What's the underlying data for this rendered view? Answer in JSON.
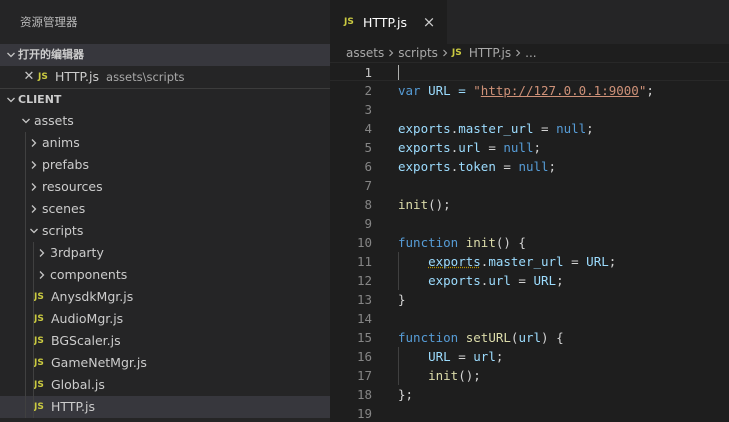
{
  "sidebar": {
    "title": "资源管理器",
    "open_editors": {
      "header": "打开的编辑器",
      "items": [
        {
          "name": "HTTP.js",
          "badge": "JS",
          "path": "assets\\scripts"
        }
      ]
    },
    "workspace": {
      "header": "CLIENT",
      "tree": [
        {
          "label": "assets",
          "kind": "folder",
          "expanded": true,
          "depth": 1
        },
        {
          "label": "anims",
          "kind": "folder",
          "expanded": false,
          "depth": 2
        },
        {
          "label": "prefabs",
          "kind": "folder",
          "expanded": false,
          "depth": 2
        },
        {
          "label": "resources",
          "kind": "folder",
          "expanded": false,
          "depth": 2
        },
        {
          "label": "scenes",
          "kind": "folder",
          "expanded": false,
          "depth": 2
        },
        {
          "label": "scripts",
          "kind": "folder",
          "expanded": true,
          "depth": 2
        },
        {
          "label": "3rdparty",
          "kind": "folder",
          "expanded": false,
          "depth": 3
        },
        {
          "label": "components",
          "kind": "folder",
          "expanded": false,
          "depth": 3
        },
        {
          "label": "AnysdkMgr.js",
          "kind": "file",
          "badge": "JS",
          "depth": 3
        },
        {
          "label": "AudioMgr.js",
          "kind": "file",
          "badge": "JS",
          "depth": 3
        },
        {
          "label": "BGScaler.js",
          "kind": "file",
          "badge": "JS",
          "depth": 3
        },
        {
          "label": "GameNetMgr.js",
          "kind": "file",
          "badge": "JS",
          "depth": 3
        },
        {
          "label": "Global.js",
          "kind": "file",
          "badge": "JS",
          "depth": 3
        },
        {
          "label": "HTTP.js",
          "kind": "file",
          "badge": "JS",
          "depth": 3,
          "selected": true
        }
      ]
    }
  },
  "editor": {
    "tab": {
      "label": "HTTP.js",
      "badge": "JS",
      "close": "×"
    },
    "breadcrumb": {
      "parts": [
        "assets",
        "scripts"
      ],
      "file": "HTTP.js",
      "badge": "JS",
      "trail": "..."
    },
    "active_line": 1,
    "lines": [
      {
        "n": "1",
        "tokens": []
      },
      {
        "n": "2",
        "tokens": [
          {
            "t": "var",
            "c": "kw"
          },
          {
            "t": " URL = ",
            "c": "var"
          },
          {
            "t": "\"",
            "c": "str"
          },
          {
            "t": "http://127.0.0.1:9000",
            "c": "str url"
          },
          {
            "t": "\"",
            "c": "str"
          },
          {
            "t": ";",
            "c": ""
          }
        ]
      },
      {
        "n": "3",
        "tokens": []
      },
      {
        "n": "4",
        "tokens": [
          {
            "t": "exports",
            "c": "var"
          },
          {
            "t": ".",
            "c": ""
          },
          {
            "t": "master_url",
            "c": "var"
          },
          {
            "t": " = ",
            "c": ""
          },
          {
            "t": "null",
            "c": "kw"
          },
          {
            "t": ";",
            "c": ""
          }
        ]
      },
      {
        "n": "5",
        "tokens": [
          {
            "t": "exports",
            "c": "var"
          },
          {
            "t": ".",
            "c": ""
          },
          {
            "t": "url",
            "c": "var"
          },
          {
            "t": " = ",
            "c": ""
          },
          {
            "t": "null",
            "c": "kw"
          },
          {
            "t": ";",
            "c": ""
          }
        ]
      },
      {
        "n": "6",
        "tokens": [
          {
            "t": "exports",
            "c": "var"
          },
          {
            "t": ".",
            "c": ""
          },
          {
            "t": "token",
            "c": "var"
          },
          {
            "t": " = ",
            "c": ""
          },
          {
            "t": "null",
            "c": "kw"
          },
          {
            "t": ";",
            "c": ""
          }
        ]
      },
      {
        "n": "7",
        "tokens": []
      },
      {
        "n": "8",
        "tokens": [
          {
            "t": "init",
            "c": "fn"
          },
          {
            "t": "();",
            "c": ""
          }
        ]
      },
      {
        "n": "9",
        "tokens": []
      },
      {
        "n": "10",
        "tokens": [
          {
            "t": "function",
            "c": "kw"
          },
          {
            "t": " ",
            "c": ""
          },
          {
            "t": "init",
            "c": "fn"
          },
          {
            "t": "() {",
            "c": ""
          }
        ]
      },
      {
        "n": "11",
        "tokens": [
          {
            "t": "    ",
            "c": ""
          },
          {
            "t": "exports",
            "c": "var squig"
          },
          {
            "t": ".",
            "c": ""
          },
          {
            "t": "master_url",
            "c": "var"
          },
          {
            "t": " = ",
            "c": ""
          },
          {
            "t": "URL",
            "c": "var"
          },
          {
            "t": ";",
            "c": ""
          }
        ]
      },
      {
        "n": "12",
        "tokens": [
          {
            "t": "    ",
            "c": ""
          },
          {
            "t": "exports",
            "c": "var"
          },
          {
            "t": ".",
            "c": ""
          },
          {
            "t": "url",
            "c": "var"
          },
          {
            "t": " = ",
            "c": ""
          },
          {
            "t": "URL",
            "c": "var"
          },
          {
            "t": ";",
            "c": ""
          }
        ]
      },
      {
        "n": "13",
        "tokens": [
          {
            "t": "}",
            "c": ""
          }
        ]
      },
      {
        "n": "14",
        "tokens": []
      },
      {
        "n": "15",
        "tokens": [
          {
            "t": "function",
            "c": "kw"
          },
          {
            "t": " ",
            "c": ""
          },
          {
            "t": "setURL",
            "c": "fn"
          },
          {
            "t": "(",
            "c": ""
          },
          {
            "t": "url",
            "c": "var"
          },
          {
            "t": ") {",
            "c": ""
          }
        ]
      },
      {
        "n": "16",
        "tokens": [
          {
            "t": "    ",
            "c": ""
          },
          {
            "t": "URL",
            "c": "var"
          },
          {
            "t": " = ",
            "c": ""
          },
          {
            "t": "url",
            "c": "var"
          },
          {
            "t": ";",
            "c": ""
          }
        ]
      },
      {
        "n": "17",
        "tokens": [
          {
            "t": "    ",
            "c": ""
          },
          {
            "t": "init",
            "c": "fn"
          },
          {
            "t": "();",
            "c": ""
          }
        ]
      },
      {
        "n": "18",
        "tokens": [
          {
            "t": "};",
            "c": ""
          }
        ]
      },
      {
        "n": "19",
        "tokens": []
      }
    ]
  },
  "colors": {
    "sidebar_bg": "#252526",
    "editor_bg": "#1e1e1e",
    "selection": "#37373d",
    "js_badge": "#cbcb41",
    "keyword": "#569cd6",
    "variable": "#9cdcfe",
    "function": "#dcdcaa",
    "string": "#ce9178"
  },
  "icons": {
    "folder_collapsed": "chevron-right-icon",
    "folder_expanded": "chevron-down-icon",
    "close": "close-icon",
    "js_file": "js-file-icon"
  }
}
